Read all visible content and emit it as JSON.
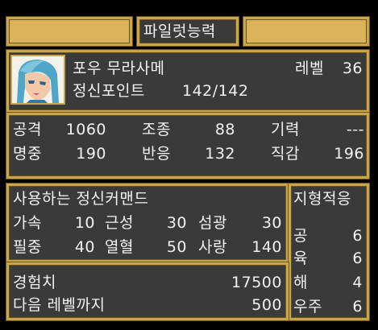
{
  "header": {
    "title": "파일럿능력"
  },
  "pilot": {
    "name": "포우 무라사메",
    "level_label": "레벨",
    "level": "36",
    "sp_label": "정신포인트",
    "sp": "142/142"
  },
  "stats": {
    "attack_label": "공격",
    "attack": "1060",
    "control_label": "조종",
    "control": "88",
    "energy_label": "기력",
    "energy": "---",
    "accuracy_label": "명중",
    "accuracy": "190",
    "reaction_label": "반응",
    "reaction": "132",
    "intuition_label": "직감",
    "intuition": "196"
  },
  "spirit": {
    "title": "사용하는 정신커맨드",
    "commands": [
      {
        "name": "가속",
        "cost": "10"
      },
      {
        "name": "근성",
        "cost": "30"
      },
      {
        "name": "섬광",
        "cost": "30"
      },
      {
        "name": "필중",
        "cost": "40"
      },
      {
        "name": "열혈",
        "cost": "50"
      },
      {
        "name": "사랑",
        "cost": "140"
      }
    ]
  },
  "terrain": {
    "title": "지형적응",
    "rows": [
      {
        "name": "공",
        "value": "6"
      },
      {
        "name": "육",
        "value": "6"
      },
      {
        "name": "해",
        "value": "4"
      },
      {
        "name": "우주",
        "value": "6"
      }
    ]
  },
  "experience": {
    "exp_label": "경험치",
    "exp": "17500",
    "next_label": "다음 레벨까지",
    "next": "500"
  },
  "colors": {
    "panel": "#3a3a3a",
    "border": "#c8a64c",
    "text": "#f2f2f2"
  }
}
